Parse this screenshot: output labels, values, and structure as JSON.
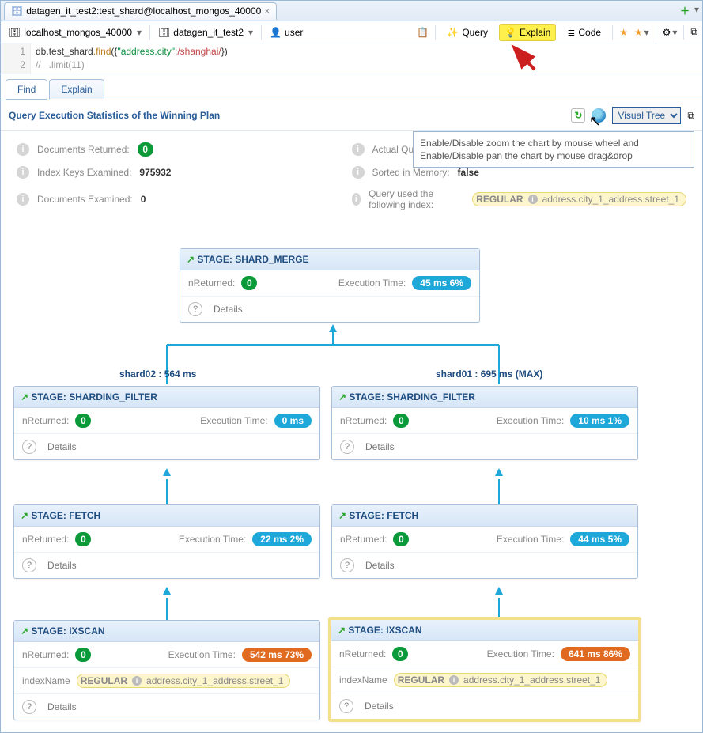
{
  "tab": {
    "title": "datagen_it_test2:test_shard@localhost_mongos_40000"
  },
  "toolbar": {
    "host": "localhost_mongos_40000",
    "database": "datagen_it_test2",
    "user": "user",
    "query_btn": "Query",
    "explain_btn": "Explain",
    "code_btn": "Code"
  },
  "editor": {
    "line1_a": "db.",
    "line1_b": "test_shard",
    "line1_c": ".find",
    "line1_d": "({",
    "line1_e": "\"address.city\"",
    "line1_f": ":",
    "line1_g": "/shanghai/",
    "line1_h": "})",
    "line2": "//   .limit(11)"
  },
  "inner_tabs": {
    "find": "Find",
    "explain": "Explain"
  },
  "panel": {
    "title": "Query Execution Statistics of the Winning Plan",
    "view_option": "Visual Tree",
    "tooltip_l1": "Enable/Disable zoom the chart by mouse wheel and",
    "tooltip_l2": "Enable/Disable pan the chart by mouse drag&drop"
  },
  "stats": {
    "docs_returned_label": "Documents Returned:",
    "docs_returned_val": "0",
    "index_keys_label": "Index Keys Examined:",
    "index_keys_val": "975932",
    "docs_examined_label": "Documents Examined:",
    "docs_examined_val": "0",
    "exec_time_label": "Actual Query Execution Time (ms):",
    "sorted_label": "Sorted in Memory:",
    "sorted_val": "false",
    "index_used_label": "Query used the following index:",
    "index_pill_type": "REGULAR",
    "index_pill_name": "address.city_1_address.street_1"
  },
  "labels": {
    "stage_prefix": "STAGE: ",
    "nreturned": "nReturned:",
    "exec_time": "Execution Time:",
    "details": "Details",
    "index_name": "indexName"
  },
  "shards": {
    "left": "shard02 : 564 ms",
    "right": "shard01 : 695 ms (MAX)"
  },
  "tree": {
    "root": {
      "name": "SHARD_MERGE",
      "nret": "0",
      "exec": "45 ms  6%",
      "exec_color": "blue"
    },
    "l_sf": {
      "name": "SHARDING_FILTER",
      "nret": "0",
      "exec": "0 ms",
      "exec_color": "blue"
    },
    "r_sf": {
      "name": "SHARDING_FILTER",
      "nret": "0",
      "exec": "10 ms  1%",
      "exec_color": "blue"
    },
    "l_fetch": {
      "name": "FETCH",
      "nret": "0",
      "exec": "22 ms  2%",
      "exec_color": "blue"
    },
    "r_fetch": {
      "name": "FETCH",
      "nret": "0",
      "exec": "44 ms  5%",
      "exec_color": "blue"
    },
    "l_ix": {
      "name": "IXSCAN",
      "nret": "0",
      "exec": "542 ms  73%",
      "exec_color": "orange",
      "idx_type": "REGULAR",
      "idx_name": "address.city_1_address.street_1"
    },
    "r_ix": {
      "name": "IXSCAN",
      "nret": "0",
      "exec": "641 ms  86%",
      "exec_color": "orange",
      "idx_type": "REGULAR",
      "idx_name": "address.city_1_address.street_1"
    }
  }
}
